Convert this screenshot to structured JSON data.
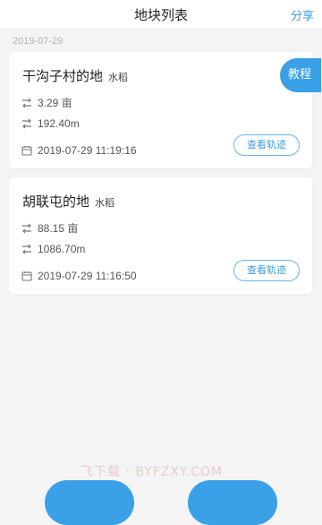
{
  "header": {
    "title": "地块列表",
    "share_label": "分享"
  },
  "group_date": "2019-07-29",
  "tutorial_label": "教程",
  "plots": [
    {
      "name": "干沟子村的地",
      "crop": "水稻",
      "area": "3.29 亩",
      "length": "192.40m",
      "time": "2019-07-29 11:19:16",
      "track_label": "查看轨迹"
    },
    {
      "name": "胡联屯的地",
      "crop": "水稻",
      "area": "88.15 亩",
      "length": "1086.70m",
      "time": "2019-07-29 11:16:50",
      "track_label": "查看轨迹"
    }
  ],
  "watermark": "飞下载 · BYFZXY.COM",
  "colors": {
    "accent": "#3aa0e8",
    "background": "#f4f4f4"
  }
}
